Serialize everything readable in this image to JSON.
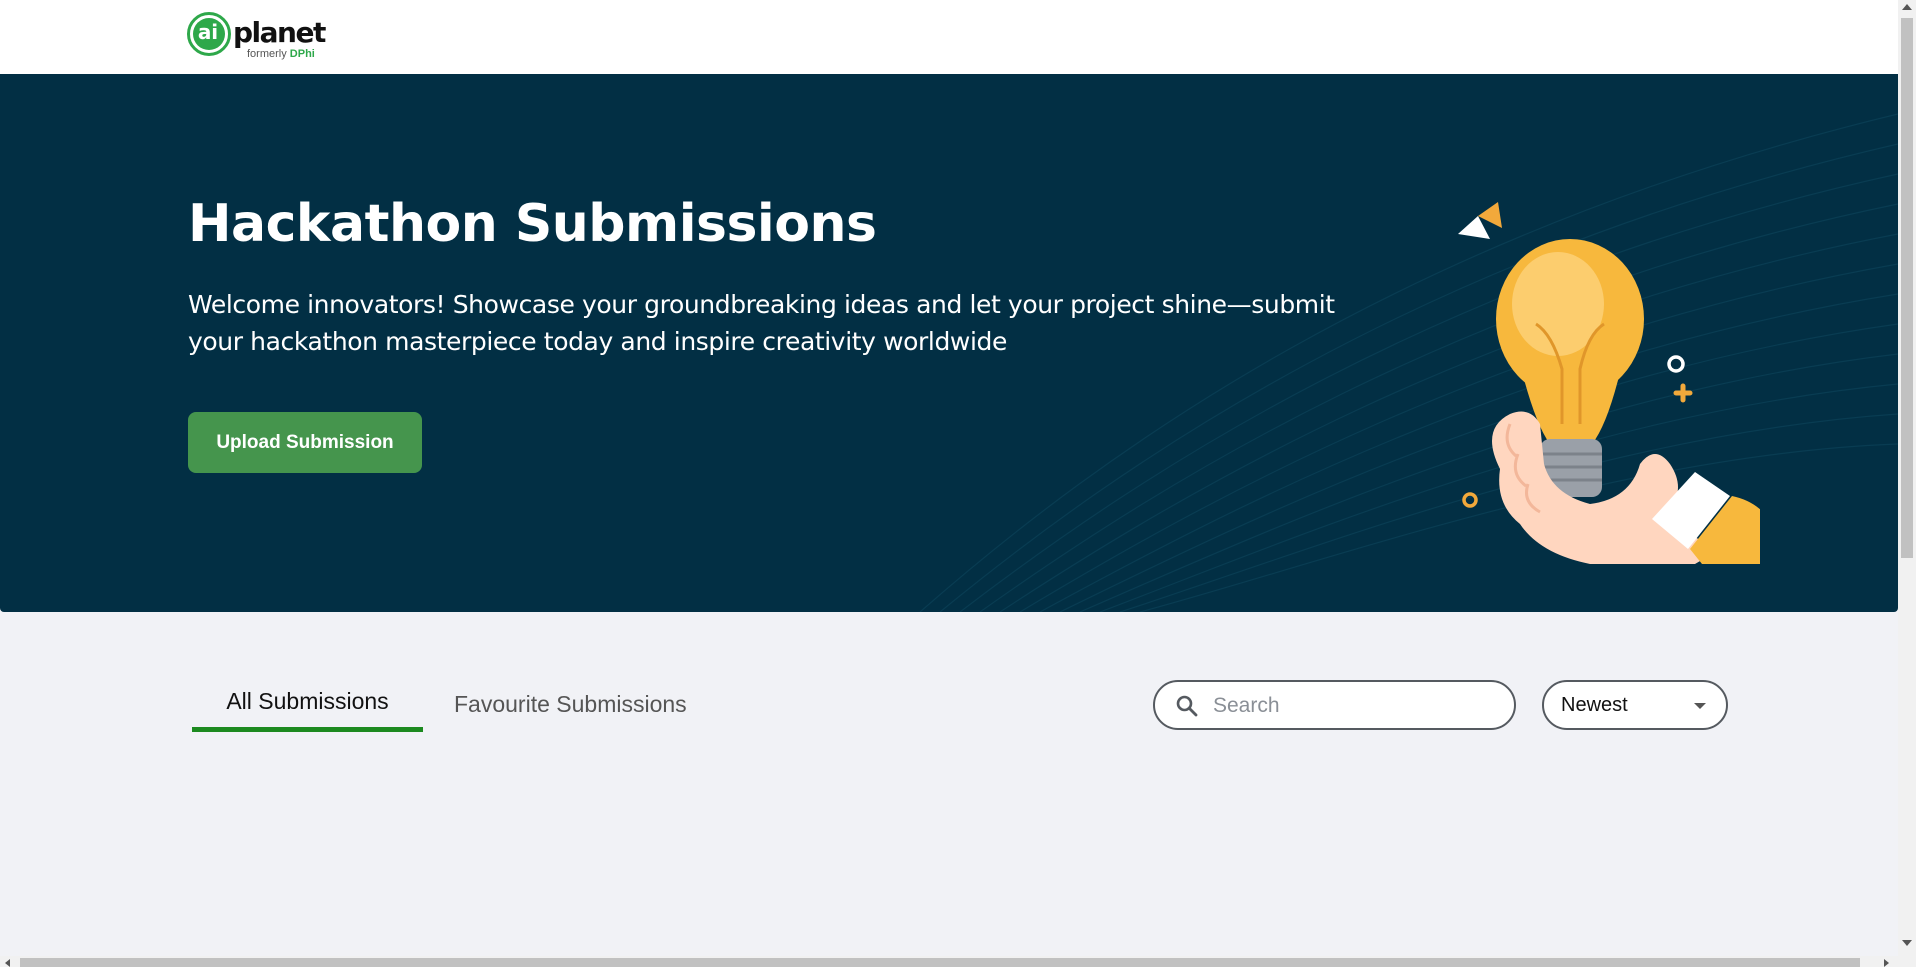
{
  "header": {
    "logo": {
      "mark_text": "ai",
      "name": "planet",
      "formerly_prefix": "formerly",
      "formerly_brand": "DPhi"
    }
  },
  "hero": {
    "title": "Hackathon Submissions",
    "description": "Welcome innovators! Showcase your groundbreaking ideas and let your project shine—submit your hackathon masterpiece today and inspire creativity worldwide",
    "upload_button_label": "Upload Submission",
    "illustration_icon": "lightbulb-hand-icon"
  },
  "tabs": [
    {
      "label": "All Submissions",
      "active": true
    },
    {
      "label": "Favourite Submissions",
      "active": false
    }
  ],
  "search": {
    "placeholder": "Search",
    "value": ""
  },
  "sort": {
    "selected": "Newest"
  },
  "colors": {
    "hero_background": "#022f44",
    "accent_green": "#45954d",
    "active_tab_underline": "#1c8a1f",
    "page_background": "#f1f2f6",
    "bulb_yellow": "#f7b83d"
  }
}
